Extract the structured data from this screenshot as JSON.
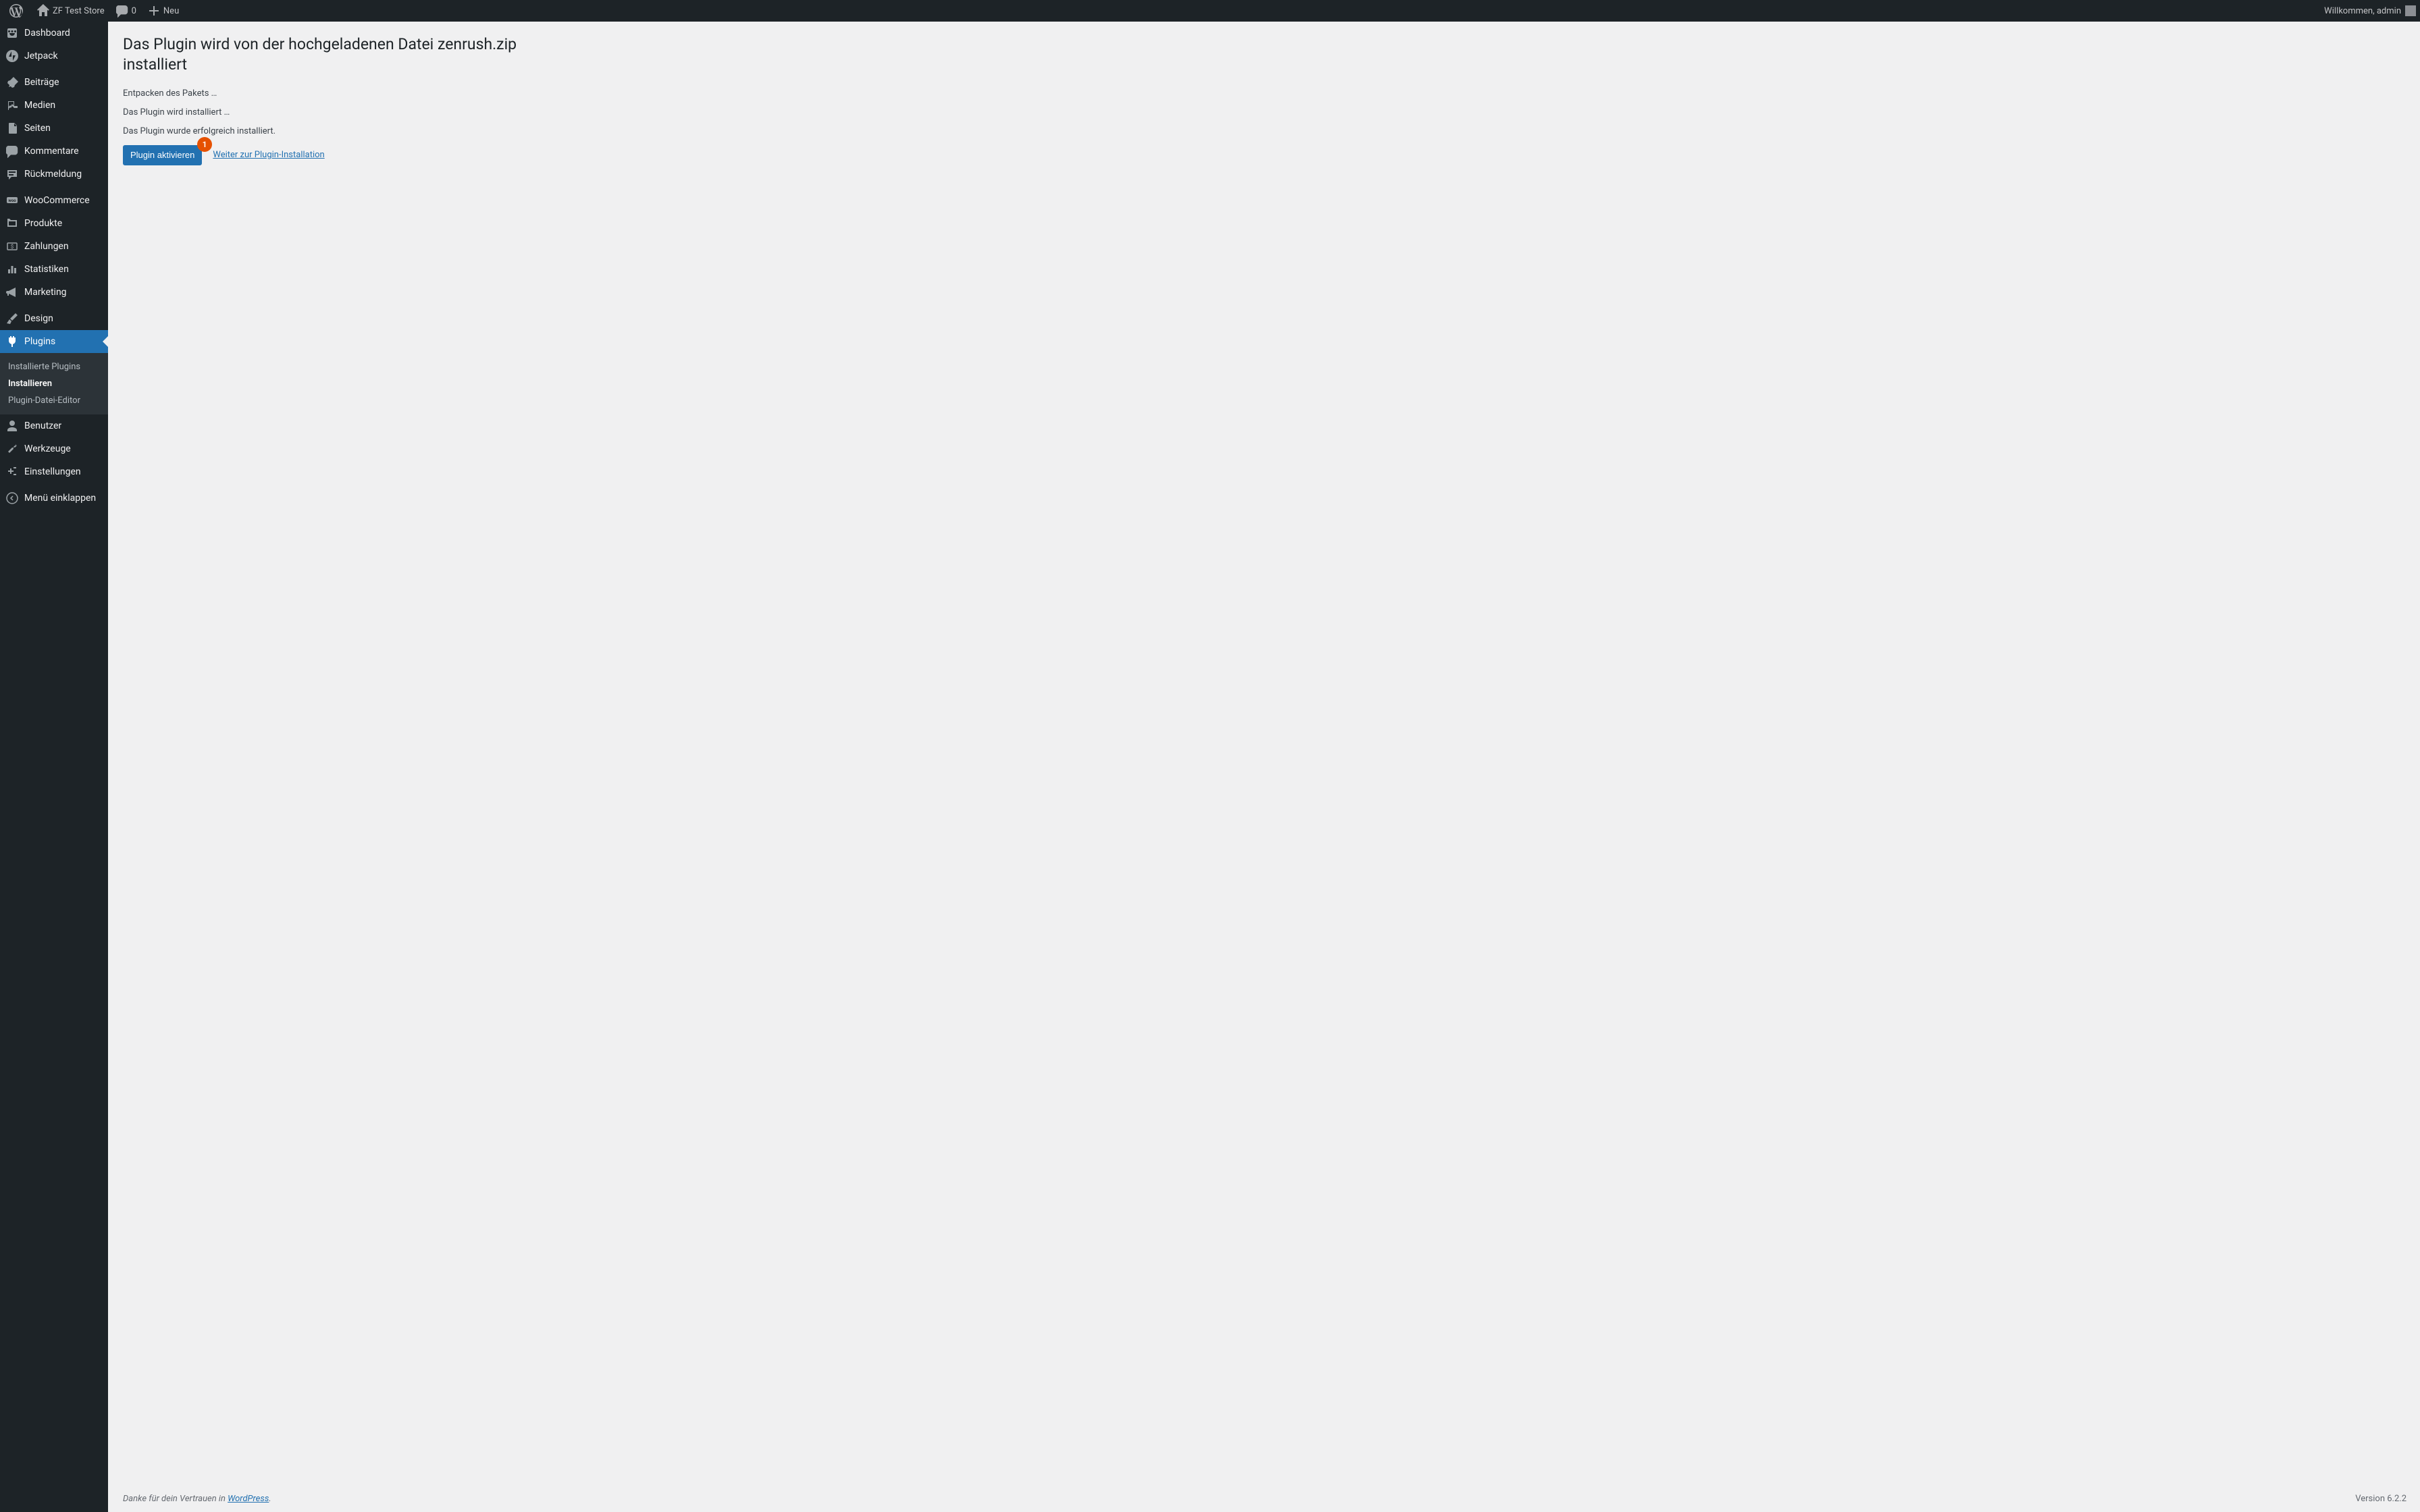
{
  "adminbar": {
    "site_name": "ZF Test Store",
    "comments_count": "0",
    "new_label": "Neu",
    "welcome_text": "Willkommen, admin"
  },
  "sidebar": {
    "items": [
      {
        "label": "Dashboard",
        "icon": "dashboard"
      },
      {
        "label": "Jetpack",
        "icon": "jetpack"
      },
      {
        "label": "Beiträge",
        "icon": "posts"
      },
      {
        "label": "Medien",
        "icon": "media"
      },
      {
        "label": "Seiten",
        "icon": "pages"
      },
      {
        "label": "Kommentare",
        "icon": "comments"
      },
      {
        "label": "Rückmeldung",
        "icon": "feedback"
      },
      {
        "label": "WooCommerce",
        "icon": "woocommerce"
      },
      {
        "label": "Produkte",
        "icon": "products"
      },
      {
        "label": "Zahlungen",
        "icon": "payments"
      },
      {
        "label": "Statistiken",
        "icon": "statistics"
      },
      {
        "label": "Marketing",
        "icon": "marketing"
      },
      {
        "label": "Design",
        "icon": "design"
      },
      {
        "label": "Plugins",
        "icon": "plugins"
      },
      {
        "label": "Benutzer",
        "icon": "users"
      },
      {
        "label": "Werkzeuge",
        "icon": "tools"
      },
      {
        "label": "Einstellungen",
        "icon": "settings"
      }
    ],
    "submenu": [
      {
        "label": "Installierte Plugins"
      },
      {
        "label": "Installieren"
      },
      {
        "label": "Plugin-Datei-Editor"
      }
    ],
    "collapse_label": "Menü einklappen"
  },
  "main": {
    "title": "Das Plugin wird von der hochgeladenen Datei zenrush.zip installiert",
    "messages": [
      "Entpacken des Pakets …",
      "Das Plugin wird installiert …",
      "Das Plugin wurde erfolgreich installiert."
    ],
    "activate_button": "Plugin aktivieren",
    "continue_link": "Weiter zur Plugin-Installation",
    "badge_number": "1"
  },
  "footer": {
    "thanks_prefix": "Danke für dein Vertrauen in ",
    "wordpress_link": "WordPress",
    "thanks_suffix": ".",
    "version": "Version 6.2.2"
  }
}
